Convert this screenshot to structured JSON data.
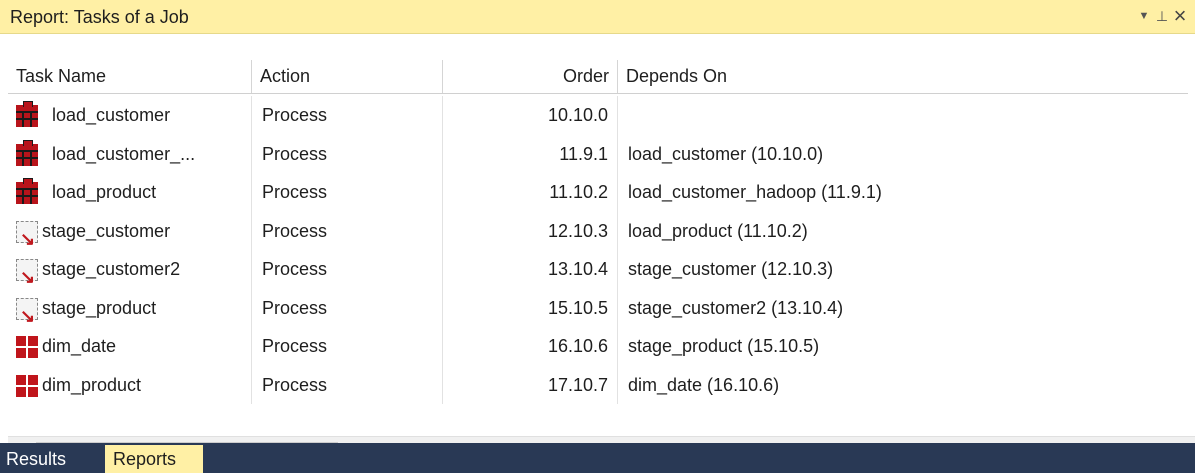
{
  "window": {
    "title": "Report: Tasks of a Job",
    "controls": {
      "menu_icon": "dropdown-arrow-icon",
      "pin_icon": "pin-icon",
      "close_icon": "close-icon"
    }
  },
  "table": {
    "columns": [
      "Task Name",
      "Action",
      "Order",
      "Depends On"
    ],
    "rows": [
      {
        "icon": "load-table-icon",
        "name": "load_customer",
        "action": "Process",
        "order": "10.10.0",
        "depends_on": ""
      },
      {
        "icon": "load-table-icon",
        "name": "load_customer_...",
        "action": "Process",
        "order": "11.9.1",
        "depends_on": "load_customer (10.10.0)"
      },
      {
        "icon": "load-table-icon",
        "name": "load_product",
        "action": "Process",
        "order": "11.10.2",
        "depends_on": "load_customer_hadoop (11.9.1)"
      },
      {
        "icon": "stage-table-icon",
        "name": "stage_customer",
        "action": "Process",
        "order": "12.10.3",
        "depends_on": "load_product (11.10.2)"
      },
      {
        "icon": "stage-table-icon",
        "name": "stage_customer2",
        "action": "Process",
        "order": "13.10.4",
        "depends_on": "stage_customer (12.10.3)"
      },
      {
        "icon": "stage-table-icon",
        "name": "stage_product",
        "action": "Process",
        "order": "15.10.5",
        "depends_on": "stage_customer2 (13.10.4)"
      },
      {
        "icon": "dimension-table-icon",
        "name": "dim_date",
        "action": "Process",
        "order": "16.10.6",
        "depends_on": "stage_product (15.10.5)"
      },
      {
        "icon": "dimension-table-icon",
        "name": "dim_product",
        "action": "Process",
        "order": "17.10.7",
        "depends_on": "dim_date (16.10.6)"
      }
    ]
  },
  "scrollbar": {
    "left_arrow": "<",
    "right_arrow": ">"
  },
  "tabs": [
    "Results",
    "Reports"
  ],
  "active_tab": "Reports",
  "colors": {
    "title_bar": "#fff0a5",
    "tab_strip": "#293955",
    "icon_red": "#c0151b"
  }
}
